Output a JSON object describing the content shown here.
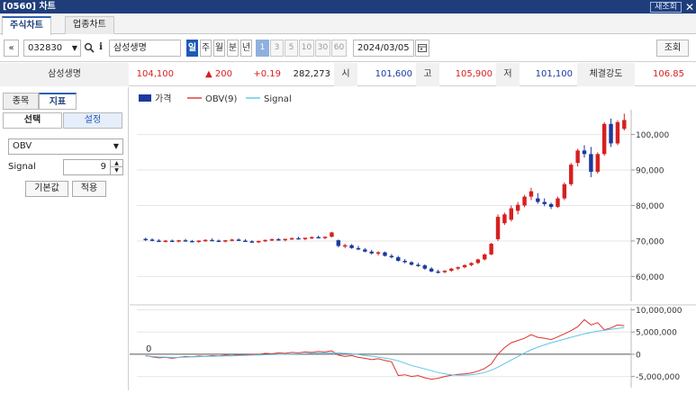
{
  "window": {
    "title": "[0560] 차트",
    "refresh_label": "새조회",
    "close_glyph": "✕"
  },
  "tabs": [
    {
      "label": "주식차트",
      "active": true
    },
    {
      "label": "업종차트",
      "active": false
    }
  ],
  "toolbar": {
    "collapse_glyph": "«",
    "code": "032830",
    "stock_name": "삼성생명",
    "info_glyph": "i",
    "periods": [
      {
        "label": "일",
        "selected": true
      },
      {
        "label": "주",
        "selected": false
      },
      {
        "label": "월",
        "selected": false
      },
      {
        "label": "분",
        "selected": false
      },
      {
        "label": "년",
        "selected": false
      }
    ],
    "intervals": [
      {
        "label": "1",
        "selected": true
      },
      {
        "label": "3",
        "selected": false
      },
      {
        "label": "5",
        "selected": false
      },
      {
        "label": "10",
        "selected": false
      },
      {
        "label": "30",
        "selected": false
      },
      {
        "label": "60",
        "selected": false
      }
    ],
    "date": "2024/03/05",
    "query_label": "조회"
  },
  "quote": {
    "name": "삼성생명",
    "price": "104,100",
    "change": "▲ 200",
    "change_pct": "+0.19",
    "volume": "282,273",
    "open_label": "시",
    "open": "101,600",
    "high_label": "고",
    "high": "105,900",
    "low_label": "저",
    "low": "101,100",
    "strength_label": "체결강도",
    "strength": "106.85",
    "up_color": "#d62020",
    "down_color": "#1a3a9c"
  },
  "left_panel": {
    "tabs": [
      {
        "label": "종목",
        "active": false
      },
      {
        "label": "지표",
        "active": true
      }
    ],
    "subtabs": [
      {
        "label": "선택",
        "active": true
      },
      {
        "label": "설정",
        "active": false
      }
    ],
    "indicator": "OBV",
    "signal_label": "Signal",
    "signal_value": "9",
    "default_label": "기본값",
    "apply_label": "적용"
  },
  "chart_data": [
    {
      "type": "candlestick",
      "legend": [
        {
          "name": "가격",
          "color": "#1a3a9c"
        },
        {
          "name": "OBV(9)",
          "color": "#e03030"
        },
        {
          "name": "Signal",
          "color": "#5cc6e6"
        }
      ],
      "y_ticks": [
        "100,000",
        "90,000",
        "80,000",
        "70,000",
        "60,000"
      ],
      "y_tick_values": [
        100000,
        90000,
        80000,
        70000,
        60000
      ],
      "ylim": [
        53000,
        107000
      ],
      "candles": [
        [
          70600,
          70900,
          70000,
          70400
        ],
        [
          70400,
          70700,
          69900,
          70100
        ],
        [
          70100,
          70500,
          69700,
          69900
        ],
        [
          69900,
          70300,
          69600,
          70100
        ],
        [
          70100,
          70400,
          69700,
          69900
        ],
        [
          69900,
          70300,
          69600,
          70200
        ],
        [
          70200,
          70600,
          69900,
          70000
        ],
        [
          70000,
          70300,
          69600,
          69800
        ],
        [
          69800,
          70200,
          69500,
          70100
        ],
        [
          70100,
          70500,
          69800,
          70300
        ],
        [
          70300,
          70700,
          70000,
          70100
        ],
        [
          70100,
          70400,
          69700,
          69900
        ],
        [
          69900,
          70300,
          69600,
          70200
        ],
        [
          70200,
          70600,
          69900,
          70400
        ],
        [
          70400,
          70700,
          70000,
          70100
        ],
        [
          70100,
          70500,
          69800,
          69900
        ],
        [
          69900,
          70200,
          69500,
          69700
        ],
        [
          69700,
          70100,
          69400,
          70000
        ],
        [
          70000,
          70400,
          69700,
          70300
        ],
        [
          70300,
          70700,
          70000,
          70500
        ],
        [
          70500,
          70800,
          70100,
          70200
        ],
        [
          70200,
          70600,
          69900,
          70600
        ],
        [
          70600,
          71000,
          70300,
          70800
        ],
        [
          70800,
          71200,
          70400,
          70500
        ],
        [
          70500,
          70900,
          70200,
          70900
        ],
        [
          70900,
          71300,
          70500,
          71100
        ],
        [
          71100,
          71500,
          70800,
          70900
        ],
        [
          70900,
          71200,
          70500,
          71200
        ],
        [
          71200,
          72600,
          71000,
          72400
        ],
        [
          70200,
          70400,
          68200,
          68600
        ],
        [
          68600,
          69200,
          68000,
          68800
        ],
        [
          68800,
          69100,
          67800,
          68000
        ],
        [
          68000,
          68600,
          67400,
          67600
        ],
        [
          67600,
          68000,
          66800,
          67000
        ],
        [
          67000,
          67500,
          66200,
          66500
        ],
        [
          66500,
          67100,
          65900,
          66800
        ],
        [
          66800,
          67000,
          65600,
          65800
        ],
        [
          65800,
          66300,
          65100,
          65400
        ],
        [
          65400,
          65800,
          64200,
          64400
        ],
        [
          64400,
          64900,
          63700,
          64000
        ],
        [
          64000,
          64300,
          63100,
          63300
        ],
        [
          63300,
          63800,
          62700,
          63100
        ],
        [
          63100,
          63400,
          61900,
          62200
        ],
        [
          62200,
          62600,
          61200,
          61400
        ],
        [
          61400,
          61900,
          60800,
          61200
        ],
        [
          61200,
          61800,
          60900,
          61600
        ],
        [
          61600,
          62400,
          61300,
          62200
        ],
        [
          62200,
          62800,
          61800,
          62600
        ],
        [
          62600,
          63400,
          62300,
          63200
        ],
        [
          63200,
          64000,
          62900,
          63800
        ],
        [
          63800,
          65000,
          63500,
          64800
        ],
        [
          64800,
          66500,
          64500,
          66200
        ],
        [
          66200,
          69500,
          66000,
          69200
        ],
        [
          70500,
          77500,
          70000,
          76800
        ],
        [
          75000,
          78000,
          74500,
          77500
        ],
        [
          76000,
          80000,
          75500,
          79200
        ],
        [
          78500,
          81000,
          77500,
          80200
        ],
        [
          80000,
          83000,
          79500,
          82500
        ],
        [
          82500,
          85000,
          81500,
          84000
        ],
        [
          82000,
          83500,
          80500,
          81000
        ],
        [
          81000,
          82000,
          79800,
          80400
        ],
        [
          80400,
          80800,
          79000,
          79600
        ],
        [
          79600,
          82500,
          79300,
          82000
        ],
        [
          82000,
          86500,
          81500,
          86000
        ],
        [
          86000,
          92000,
          85500,
          91500
        ],
        [
          92000,
          96000,
          91000,
          95500
        ],
        [
          95500,
          97000,
          93500,
          94500
        ],
        [
          94500,
          96500,
          88000,
          89500
        ],
        [
          89500,
          95000,
          89000,
          94500
        ],
        [
          94500,
          103500,
          94000,
          103000
        ],
        [
          103000,
          104500,
          96500,
          97500
        ],
        [
          97500,
          104000,
          97000,
          103500
        ],
        [
          101600,
          105900,
          101100,
          104100
        ]
      ]
    },
    {
      "type": "line",
      "zero_label": "0",
      "y_ticks": [
        "10,000,000",
        "5,000,000",
        "0",
        "-5,000,000"
      ],
      "y_tick_values": [
        10000000,
        5000000,
        0,
        -5000000
      ],
      "ylim": [
        -7500000,
        10500000
      ],
      "series": [
        {
          "name": "OBV(9)",
          "color": "#e03030",
          "values": [
            -300000,
            -600000,
            -800000,
            -700000,
            -900000,
            -700000,
            -500000,
            -600000,
            -400000,
            -500000,
            -300000,
            -400000,
            -200000,
            -300000,
            -100000,
            -200000,
            0,
            -100000,
            200000,
            100000,
            300000,
            200000,
            400000,
            300000,
            500000,
            400000,
            600000,
            500000,
            800000,
            -200000,
            -500000,
            -300000,
            -700000,
            -900000,
            -1200000,
            -1000000,
            -1400000,
            -1700000,
            -4800000,
            -4600000,
            -5000000,
            -4800000,
            -5300000,
            -5600000,
            -5400000,
            -5000000,
            -4700000,
            -4500000,
            -4400000,
            -4200000,
            -3800000,
            -3200000,
            -2200000,
            0,
            1500000,
            2600000,
            3100000,
            3600000,
            4400000,
            3800000,
            3600000,
            3300000,
            3900000,
            4600000,
            5300000,
            6200000,
            7800000,
            6600000,
            7100000,
            5500000,
            5900000,
            6600000,
            6400000
          ]
        },
        {
          "name": "Signal",
          "color": "#5cc6e6",
          "values": [
            -400000,
            -500000,
            -600000,
            -650000,
            -700000,
            -700000,
            -650000,
            -600000,
            -550000,
            -500000,
            -450000,
            -420000,
            -380000,
            -340000,
            -300000,
            -260000,
            -200000,
            -160000,
            -120000,
            -80000,
            -30000,
            0,
            50000,
            100000,
            150000,
            200000,
            250000,
            300000,
            350000,
            300000,
            200000,
            100000,
            -50000,
            -250000,
            -450000,
            -650000,
            -850000,
            -1100000,
            -1500000,
            -2000000,
            -2500000,
            -2900000,
            -3300000,
            -3700000,
            -4100000,
            -4400000,
            -4600000,
            -4700000,
            -4700000,
            -4600000,
            -4400000,
            -4100000,
            -3600000,
            -2900000,
            -2100000,
            -1300000,
            -500000,
            300000,
            1000000,
            1600000,
            2100000,
            2600000,
            3000000,
            3400000,
            3800000,
            4200000,
            4600000,
            4900000,
            5200000,
            5400000,
            5600000,
            5800000,
            6000000
          ]
        }
      ]
    }
  ]
}
